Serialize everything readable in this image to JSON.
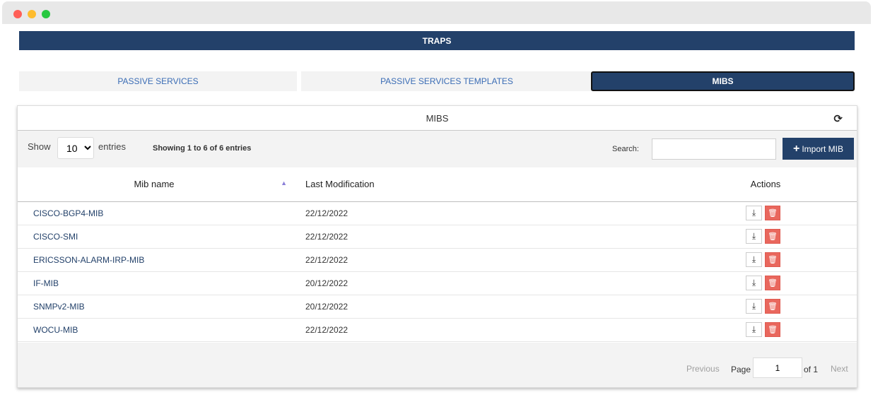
{
  "window": {
    "controls": [
      "close",
      "minimize",
      "maximize"
    ]
  },
  "header": {
    "title": "TRAPS"
  },
  "tabs": [
    {
      "label": "PASSIVE SERVICES",
      "active": false
    },
    {
      "label": "PASSIVE SERVICES TEMPLATES",
      "active": false
    },
    {
      "label": "MIBS",
      "active": true
    }
  ],
  "panel": {
    "title": "MIBS",
    "refresh_icon": "refresh-icon",
    "toolbar": {
      "show_label": "Show",
      "page_size": "10",
      "entries_label": "entries",
      "info": "Showing 1 to 6 of 6 entries",
      "search_label": "Search:",
      "search_value": "",
      "import_label": "Import MIB",
      "import_icon": "plus-icon"
    },
    "table": {
      "columns": [
        "Mib name",
        "Last Modification",
        "Actions"
      ],
      "sort_icon": "sort-asc-icon",
      "rows": [
        {
          "name": "CISCO-BGP4-MIB",
          "date": "22/12/2022"
        },
        {
          "name": "CISCO-SMI",
          "date": "22/12/2022"
        },
        {
          "name": "ERICSSON-ALARM-IRP-MIB",
          "date": "22/12/2022"
        },
        {
          "name": "IF-MIB",
          "date": "20/12/2022"
        },
        {
          "name": "SNMPv2-MIB",
          "date": "20/12/2022"
        },
        {
          "name": "WOCU-MIB",
          "date": "22/12/2022"
        }
      ],
      "row_actions": [
        "download-icon",
        "trash-icon"
      ]
    },
    "pagination": {
      "previous": "Previous",
      "page_label": "Page",
      "page_value": "1",
      "of_label": "of 1",
      "next": "Next"
    }
  },
  "colors": {
    "primary": "#23416a",
    "danger": "#e9675d",
    "link": "#3a6cb5"
  }
}
